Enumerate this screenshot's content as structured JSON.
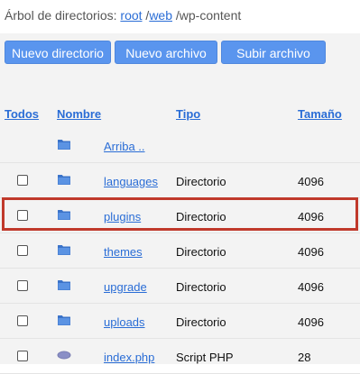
{
  "breadcrumb": {
    "prefix": "Árbol de directorios: ",
    "root": "root",
    "sep1": " /",
    "web": "web",
    "tail": " /wp-content"
  },
  "toolbar": {
    "new_dir": "Nuevo directorio",
    "new_file": "Nuevo archivo",
    "upload": "Subir archivo"
  },
  "table": {
    "headers": {
      "all": "Todos",
      "name": "Nombre",
      "type": "Tipo",
      "size": "Tamaño"
    },
    "rows": [
      {
        "name": "Arriba ..",
        "type": "",
        "size": "",
        "icon": "folder-icon",
        "checkbox": false
      },
      {
        "name": "languages",
        "type": "Directorio",
        "size": "4096",
        "icon": "folder-icon",
        "checkbox": true
      },
      {
        "name": "plugins",
        "type": "Directorio",
        "size": "4096",
        "icon": "folder-icon",
        "checkbox": true
      },
      {
        "name": "themes",
        "type": "Directorio",
        "size": "4096",
        "icon": "folder-icon",
        "checkbox": true
      },
      {
        "name": "upgrade",
        "type": "Directorio",
        "size": "4096",
        "icon": "folder-icon",
        "checkbox": true
      },
      {
        "name": "uploads",
        "type": "Directorio",
        "size": "4096",
        "icon": "folder-icon",
        "checkbox": true
      },
      {
        "name": "index.php",
        "type": "Script PHP",
        "size": "28",
        "icon": "php-file-icon",
        "checkbox": true
      }
    ]
  },
  "colors": {
    "accent": "#5a95ee",
    "link": "#2a6dd6",
    "highlight": "#c0392b",
    "folder": "#3b73c9"
  }
}
